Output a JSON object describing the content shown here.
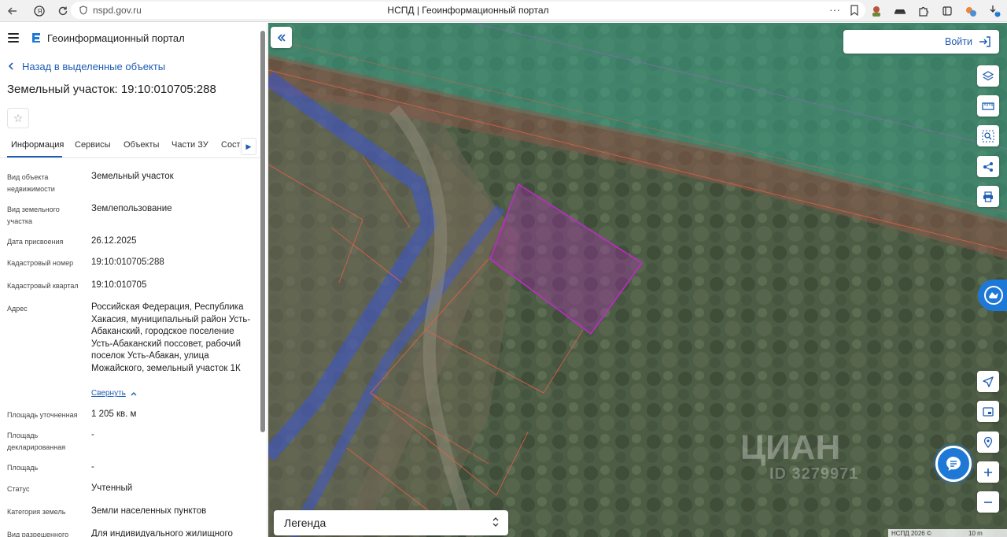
{
  "browser": {
    "url": "nspd.gov.ru",
    "tab_title": "НСПД | Геоинформационный портал",
    "menu_dots": "···",
    "ext_badge": "3"
  },
  "sidebar": {
    "portal_name": "Геоинформационный портал",
    "back_label": "Назад в выделенные объекты",
    "object_title": "Земельный участок: 19:10:010705:288",
    "tabs": [
      {
        "label": "Информация"
      },
      {
        "label": "Сервисы"
      },
      {
        "label": "Объекты"
      },
      {
        "label": "Части ЗУ"
      },
      {
        "label": "Соста"
      }
    ],
    "properties": [
      {
        "label": "Вид объекта недвижимости",
        "value": "Земельный участок"
      },
      {
        "label": "Вид земельного участка",
        "value": "Землепользование"
      },
      {
        "label": "Дата присвоения",
        "value": "26.12.2025"
      },
      {
        "label": "Кадастровый номер",
        "value": "19:10:010705:288"
      },
      {
        "label": "Кадастровый квартал",
        "value": "19:10:010705"
      },
      {
        "label": "Адрес",
        "value": "Российская Федерация, Республика Хакасия, муниципальный район Усть-Абаканский, городское поселение Усть-Абаканский поссовет, рабочий поселок Усть-Абакан, улица Можайского, земельный участок 1К"
      },
      {
        "label": "Площадь уточненная",
        "value": "1 205 кв. м"
      },
      {
        "label": "Площадь декларированная",
        "value": "-"
      },
      {
        "label": "Площадь",
        "value": "-"
      },
      {
        "label": "Статус",
        "value": "Учтенный"
      },
      {
        "label": "Категория земель",
        "value": "Земли населенных пунктов"
      },
      {
        "label": "Вид разрешенного",
        "value": "Для индивидуального жилищного"
      }
    ],
    "collapse_label": "Свернуть"
  },
  "map": {
    "login_label": "Войти",
    "legend_label": "Легенда",
    "copyright": "НСПД 2026 ©",
    "scale_label": "10 m",
    "watermark": "ЦИАН",
    "watermark_id": "ID 3279971"
  },
  "colors": {
    "accent": "#1e5cb3",
    "parcel_highlight": "#b02ab8",
    "road_overlay": "#3b55d6",
    "water_overlay": "#3aa58a",
    "boundary_line": "#e0604a"
  }
}
